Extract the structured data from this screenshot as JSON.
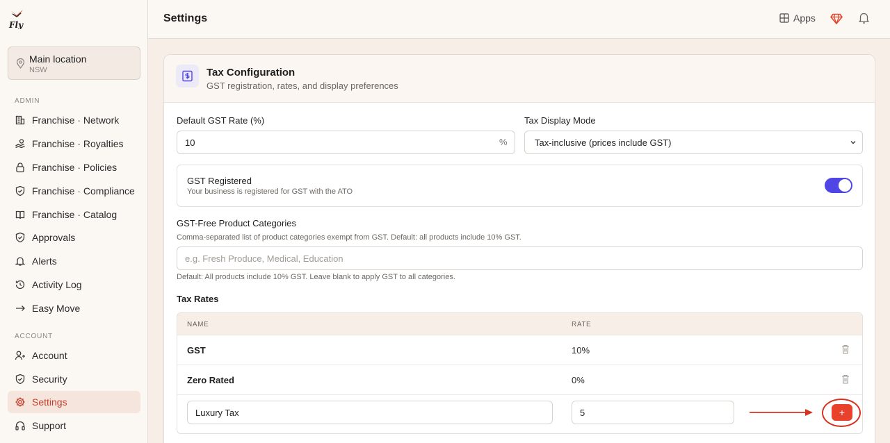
{
  "app": {
    "brand": "Fly"
  },
  "sidebar": {
    "location": {
      "name": "Main location",
      "region": "NSW"
    },
    "admin_label": "ADMIN",
    "admin_items": [
      {
        "label": "Franchise · Network",
        "icon": "building-icon"
      },
      {
        "label": "Franchise · Royalties",
        "icon": "hand-coins-icon"
      },
      {
        "label": "Franchise · Policies",
        "icon": "lock-icon"
      },
      {
        "label": "Franchise · Compliance",
        "icon": "shield-check-icon"
      },
      {
        "label": "Franchise · Catalog",
        "icon": "book-icon"
      },
      {
        "label": "Approvals",
        "icon": "shield-check-icon"
      },
      {
        "label": "Alerts",
        "icon": "bell-icon"
      },
      {
        "label": "Activity Log",
        "icon": "history-icon"
      },
      {
        "label": "Easy Move",
        "icon": "arrow-right-icon"
      }
    ],
    "account_label": "ACCOUNT",
    "account_items": [
      {
        "label": "Account",
        "icon": "user-icon"
      },
      {
        "label": "Security",
        "icon": "shield-icon"
      },
      {
        "label": "Settings",
        "icon": "gear-icon",
        "active": true
      },
      {
        "label": "Support",
        "icon": "headphones-icon"
      }
    ]
  },
  "header": {
    "title": "Settings",
    "apps_label": "Apps"
  },
  "card": {
    "title": "Tax Configuration",
    "subtitle": "GST registration, rates, and display preferences",
    "default_rate_label": "Default GST Rate (%)",
    "default_rate_value": "10",
    "default_rate_suffix": "%",
    "display_mode_label": "Tax Display Mode",
    "display_mode_value": "Tax-inclusive (prices include GST)",
    "gst_registered_title": "GST Registered",
    "gst_registered_desc": "Your business is registered for GST with the ATO",
    "gst_registered_on": true,
    "free_cat_label": "GST-Free Product Categories",
    "free_cat_help": "Comma-separated list of product categories exempt from GST. Default: all products include 10% GST.",
    "free_cat_placeholder": "e.g. Fresh Produce, Medical, Education",
    "free_cat_note": "Default: All products include 10% GST. Leave blank to apply GST to all categories.",
    "rates_title": "Tax Rates",
    "table": {
      "headers": {
        "name": "NAME",
        "rate": "RATE"
      },
      "rows": [
        {
          "name": "GST",
          "rate": "10%"
        },
        {
          "name": "Zero Rated",
          "rate": "0%"
        }
      ],
      "new_row": {
        "name": "Luxury Tax",
        "rate": "5",
        "add_label": "+"
      }
    }
  },
  "colors": {
    "accent": "#c2412d",
    "toggle": "#4f46e5",
    "add_button": "#e8412c",
    "annotation": "#d8321e"
  }
}
